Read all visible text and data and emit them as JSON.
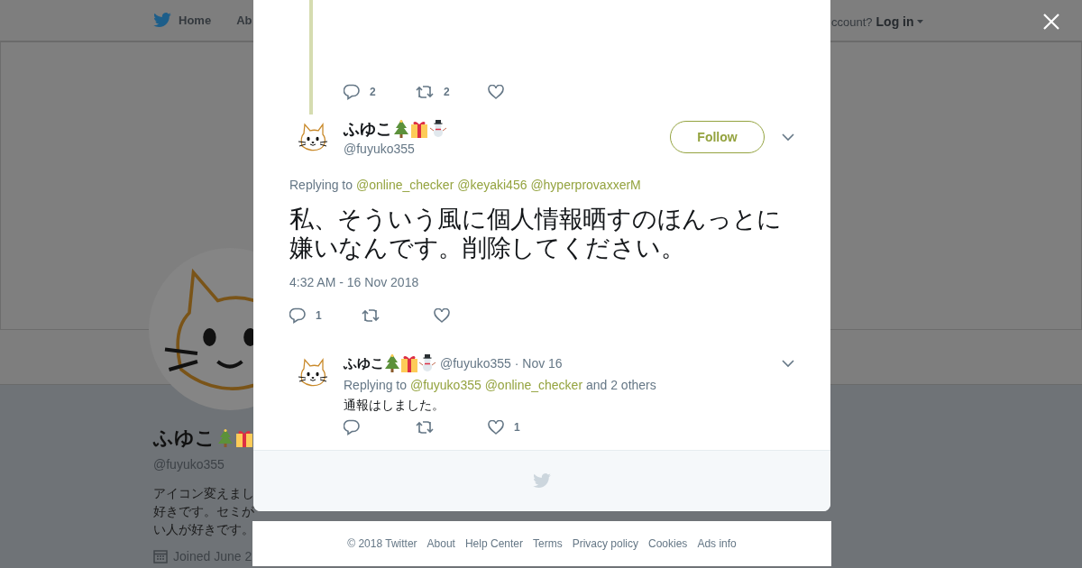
{
  "background_page": {
    "nav": [
      {
        "label": "Home"
      },
      {
        "label": "Ab"
      }
    ],
    "login_prompt": "ccount?",
    "login": "Log in",
    "profile": {
      "name": "ふゆこ",
      "handle": "@fuyuko355",
      "bio_lines": [
        "アイコン変えまし",
        "好きです。セミが",
        "い人が好きです。"
      ],
      "joined": "Joined June 2"
    }
  },
  "modal": {
    "parent_actions": [
      {
        "kind": "reply",
        "count": "2"
      },
      {
        "kind": "retweet",
        "count": "2"
      },
      {
        "kind": "like"
      }
    ],
    "tweet": {
      "name": "ふゆこ",
      "handle": "@fuyuko355",
      "follow": "Follow",
      "replying_label": "Replying to",
      "mentions": [
        "@online_checker",
        "@keyaki456",
        "@hyperprovaxxerM"
      ],
      "text": "私、そういう風に個人情報晒すのほんっとに嫌いなんです。削除してください。",
      "date": "4:32 AM - 16 Nov 2018",
      "actions": [
        {
          "kind": "reply",
          "count": "1"
        },
        {
          "kind": "retweet"
        },
        {
          "kind": "like"
        }
      ]
    },
    "replies": [
      {
        "name": "ふゆこ",
        "handle": "@fuyuko355",
        "date": "· Nov 16",
        "replying_label": "Replying to",
        "mentions": [
          "@fuyuko355",
          "@online_checker"
        ],
        "others": "and 2 others",
        "text": "通報はしました。",
        "actions": [
          {
            "kind": "reply"
          },
          {
            "kind": "retweet"
          },
          {
            "kind": "like",
            "count": "1"
          }
        ]
      }
    ]
  },
  "footer": {
    "links": [
      "© 2018 Twitter",
      "About",
      "Help Center",
      "Terms",
      "Privacy policy",
      "Cookies",
      "Ads info"
    ]
  }
}
